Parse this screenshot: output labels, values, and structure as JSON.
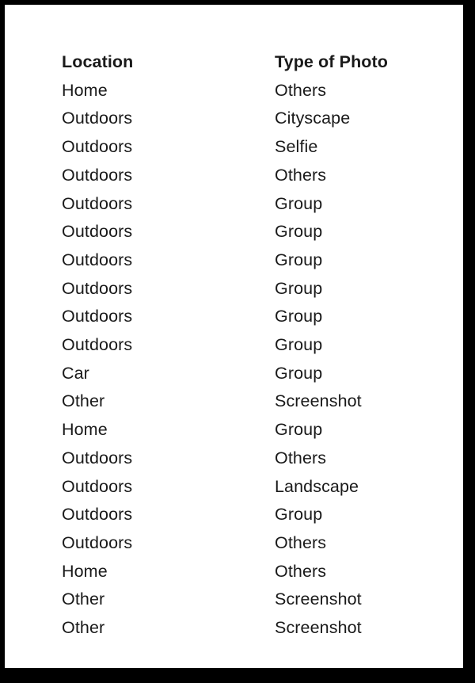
{
  "table": {
    "columns": [
      {
        "key": "location",
        "header": "Location"
      },
      {
        "key": "type_of_photo",
        "header": "Type of Photo"
      }
    ],
    "rows": [
      {
        "location": "Home",
        "type_of_photo": "Others"
      },
      {
        "location": "Outdoors",
        "type_of_photo": "Cityscape"
      },
      {
        "location": "Outdoors",
        "type_of_photo": "Selfie"
      },
      {
        "location": "Outdoors",
        "type_of_photo": "Others"
      },
      {
        "location": "Outdoors",
        "type_of_photo": "Group"
      },
      {
        "location": "Outdoors",
        "type_of_photo": "Group"
      },
      {
        "location": "Outdoors",
        "type_of_photo": "Group"
      },
      {
        "location": "Outdoors",
        "type_of_photo": "Group"
      },
      {
        "location": "Outdoors",
        "type_of_photo": "Group"
      },
      {
        "location": "Outdoors",
        "type_of_photo": "Group"
      },
      {
        "location": "Car",
        "type_of_photo": "Group"
      },
      {
        "location": "Other",
        "type_of_photo": "Screenshot"
      },
      {
        "location": "Home",
        "type_of_photo": "Group"
      },
      {
        "location": "Outdoors",
        "type_of_photo": "Others"
      },
      {
        "location": "Outdoors",
        "type_of_photo": "Landscape"
      },
      {
        "location": "Outdoors",
        "type_of_photo": "Group"
      },
      {
        "location": "Outdoors",
        "type_of_photo": "Others"
      },
      {
        "location": "Home",
        "type_of_photo": "Others"
      },
      {
        "location": "Other",
        "type_of_photo": "Screenshot"
      },
      {
        "location": "Other",
        "type_of_photo": "Screenshot"
      }
    ]
  },
  "style": {
    "text_color": "#1a1a1a",
    "background_color": "#ffffff",
    "frame_color": "#000000"
  }
}
